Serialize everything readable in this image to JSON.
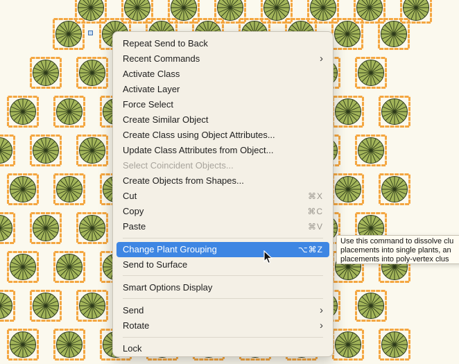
{
  "menu": {
    "items": [
      {
        "label": "Repeat Send to Back"
      },
      {
        "label": "Recent Commands",
        "submenu": true
      },
      {
        "label": "Activate Class"
      },
      {
        "label": "Activate Layer"
      },
      {
        "label": "Force Select"
      },
      {
        "label": "Create Similar Object"
      },
      {
        "label": "Create Class using Object Attributes..."
      },
      {
        "label": "Update Class Attributes from Object..."
      },
      {
        "label": "Select Coincident Objects...",
        "disabled": true
      },
      {
        "label": "Create Objects from Shapes..."
      },
      {
        "label": "Cut",
        "shortcut": "⌘X"
      },
      {
        "label": "Copy",
        "shortcut": "⌘C"
      },
      {
        "label": "Paste",
        "shortcut": "⌘V"
      },
      {
        "label": "Change Plant Grouping",
        "shortcut": "⌥⌘Z",
        "highlighted": true
      },
      {
        "label": "Send to Surface"
      },
      {
        "label": "Smart Options Display"
      },
      {
        "label": "Send",
        "submenu": true
      },
      {
        "label": "Rotate",
        "submenu": true
      },
      {
        "label": "Lock"
      }
    ]
  },
  "tooltip": {
    "line1": "Use this command to dissolve clu",
    "line2": "placements into single plants, an",
    "line3": "placements into poly-vertex clus"
  },
  "colors": {
    "canvas_bg": "#fbf9ee",
    "plant_frame": "#f4a640",
    "plant_fill": "#a3b55a",
    "menu_highlight": "#3e86e3"
  },
  "icons": {
    "submenu": "chevron-right-icon",
    "plant": "plant-symbol-icon",
    "cursor": "arrow-cursor-icon"
  }
}
